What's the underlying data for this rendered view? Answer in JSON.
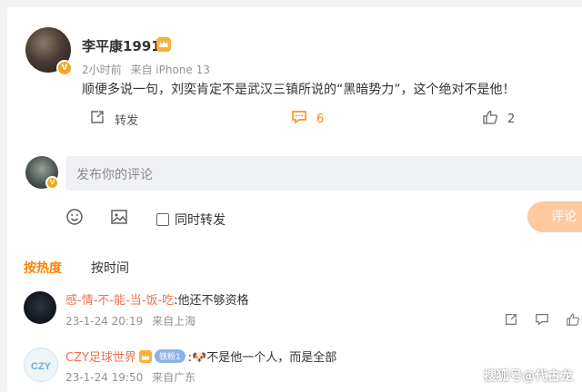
{
  "post": {
    "author": "李平康1991",
    "time": "2小时前",
    "source": "来自 iPhone 13",
    "content": "顺便多说一句，刘奕肯定不是武汉三镇所说的“黑暗势力”，这个绝对不是他！",
    "repost_label": "转发",
    "comment_count": "6",
    "like_count": "2"
  },
  "composer": {
    "placeholder": "发布你的评论",
    "repost_checkbox_label": "同时转发",
    "submit_label": "评论"
  },
  "sort_tabs": [
    "按热度",
    "按时间"
  ],
  "comments": [
    {
      "username": "感-情-不-能-当-饭-吃",
      "text": ":他还不够资格",
      "date": "23-1-24 20:19",
      "location": "来自上海"
    },
    {
      "username": "CZY足球世界",
      "badge": "铁粉1",
      "text": ":🐶不是他一个人，而是全部",
      "date": "23-1-24 19:50",
      "location": "来自广东"
    }
  ],
  "watermark": "搜狐号@代古龙",
  "colors": {
    "accent": "#ff8200",
    "username": "#eb7350",
    "submit_bg": "#ffc9a0"
  }
}
